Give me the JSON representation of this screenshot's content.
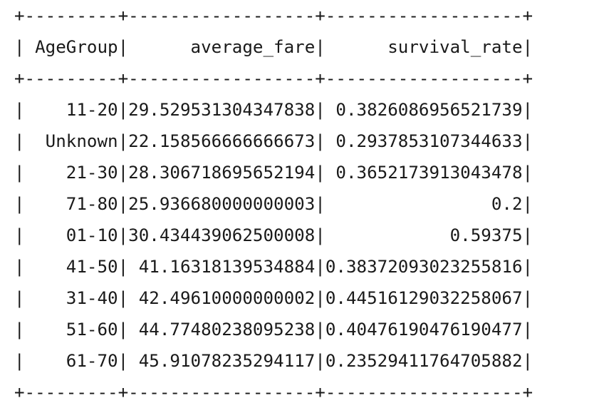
{
  "table": {
    "columns": [
      "AgeGroup",
      "average_fare",
      "survival_rate"
    ],
    "rows": [
      [
        "11-20",
        "29.529531304347838",
        "0.3826086956521739"
      ],
      [
        "Unknown",
        "22.158566666666673",
        "0.2937853107344633"
      ],
      [
        "21-30",
        "28.306718695652194",
        "0.3652173913043478"
      ],
      [
        "71-80",
        "25.936680000000003",
        "0.2"
      ],
      [
        "01-10",
        "30.434439062500008",
        "0.59375"
      ],
      [
        "41-50",
        "41.16318139534884",
        "0.38372093023255816"
      ],
      [
        "31-40",
        "42.49610000000002",
        "0.44516129032258067"
      ],
      [
        "51-60",
        "44.77480238095238",
        "0.40476190476190477"
      ],
      [
        "61-70",
        "45.91078235294117",
        "0.23529411764705882"
      ]
    ]
  }
}
